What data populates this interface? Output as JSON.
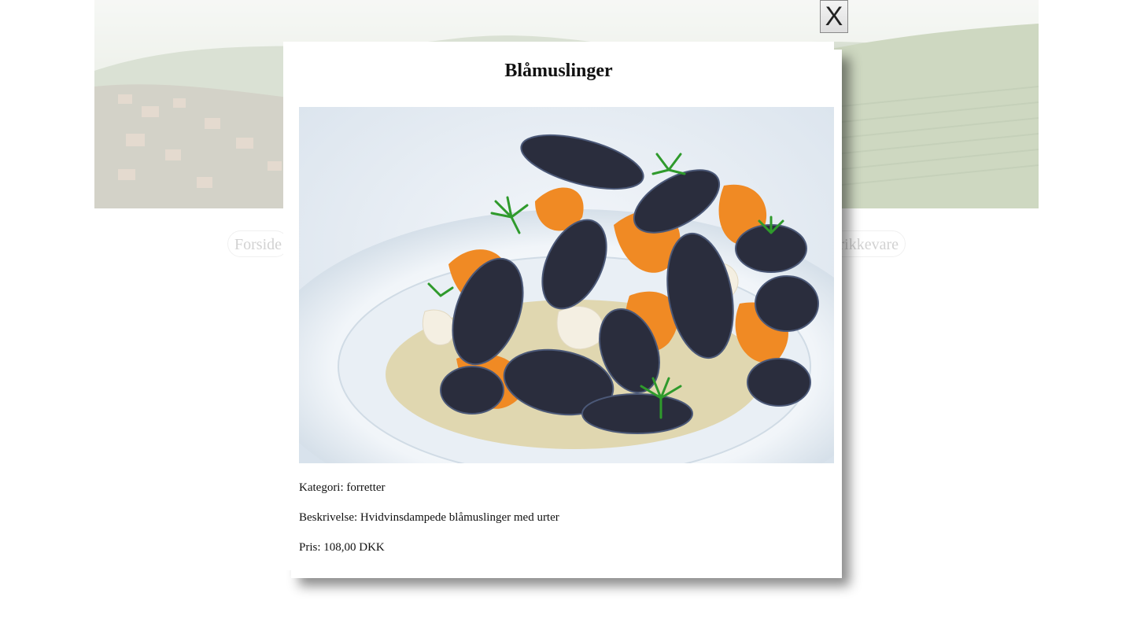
{
  "background": {
    "nav": {
      "left_label": "Forside",
      "right_label": "Drikkevare"
    }
  },
  "modal": {
    "title": "Blåmuslinger",
    "close_label": "X",
    "category_line": "Kategori: forretter",
    "description_line": "Beskrivelse: Hvidvinsdampede blåmuslinger med urter",
    "price_line": "Pris: 108,00 DKK",
    "image_icon": "dish-photo"
  }
}
